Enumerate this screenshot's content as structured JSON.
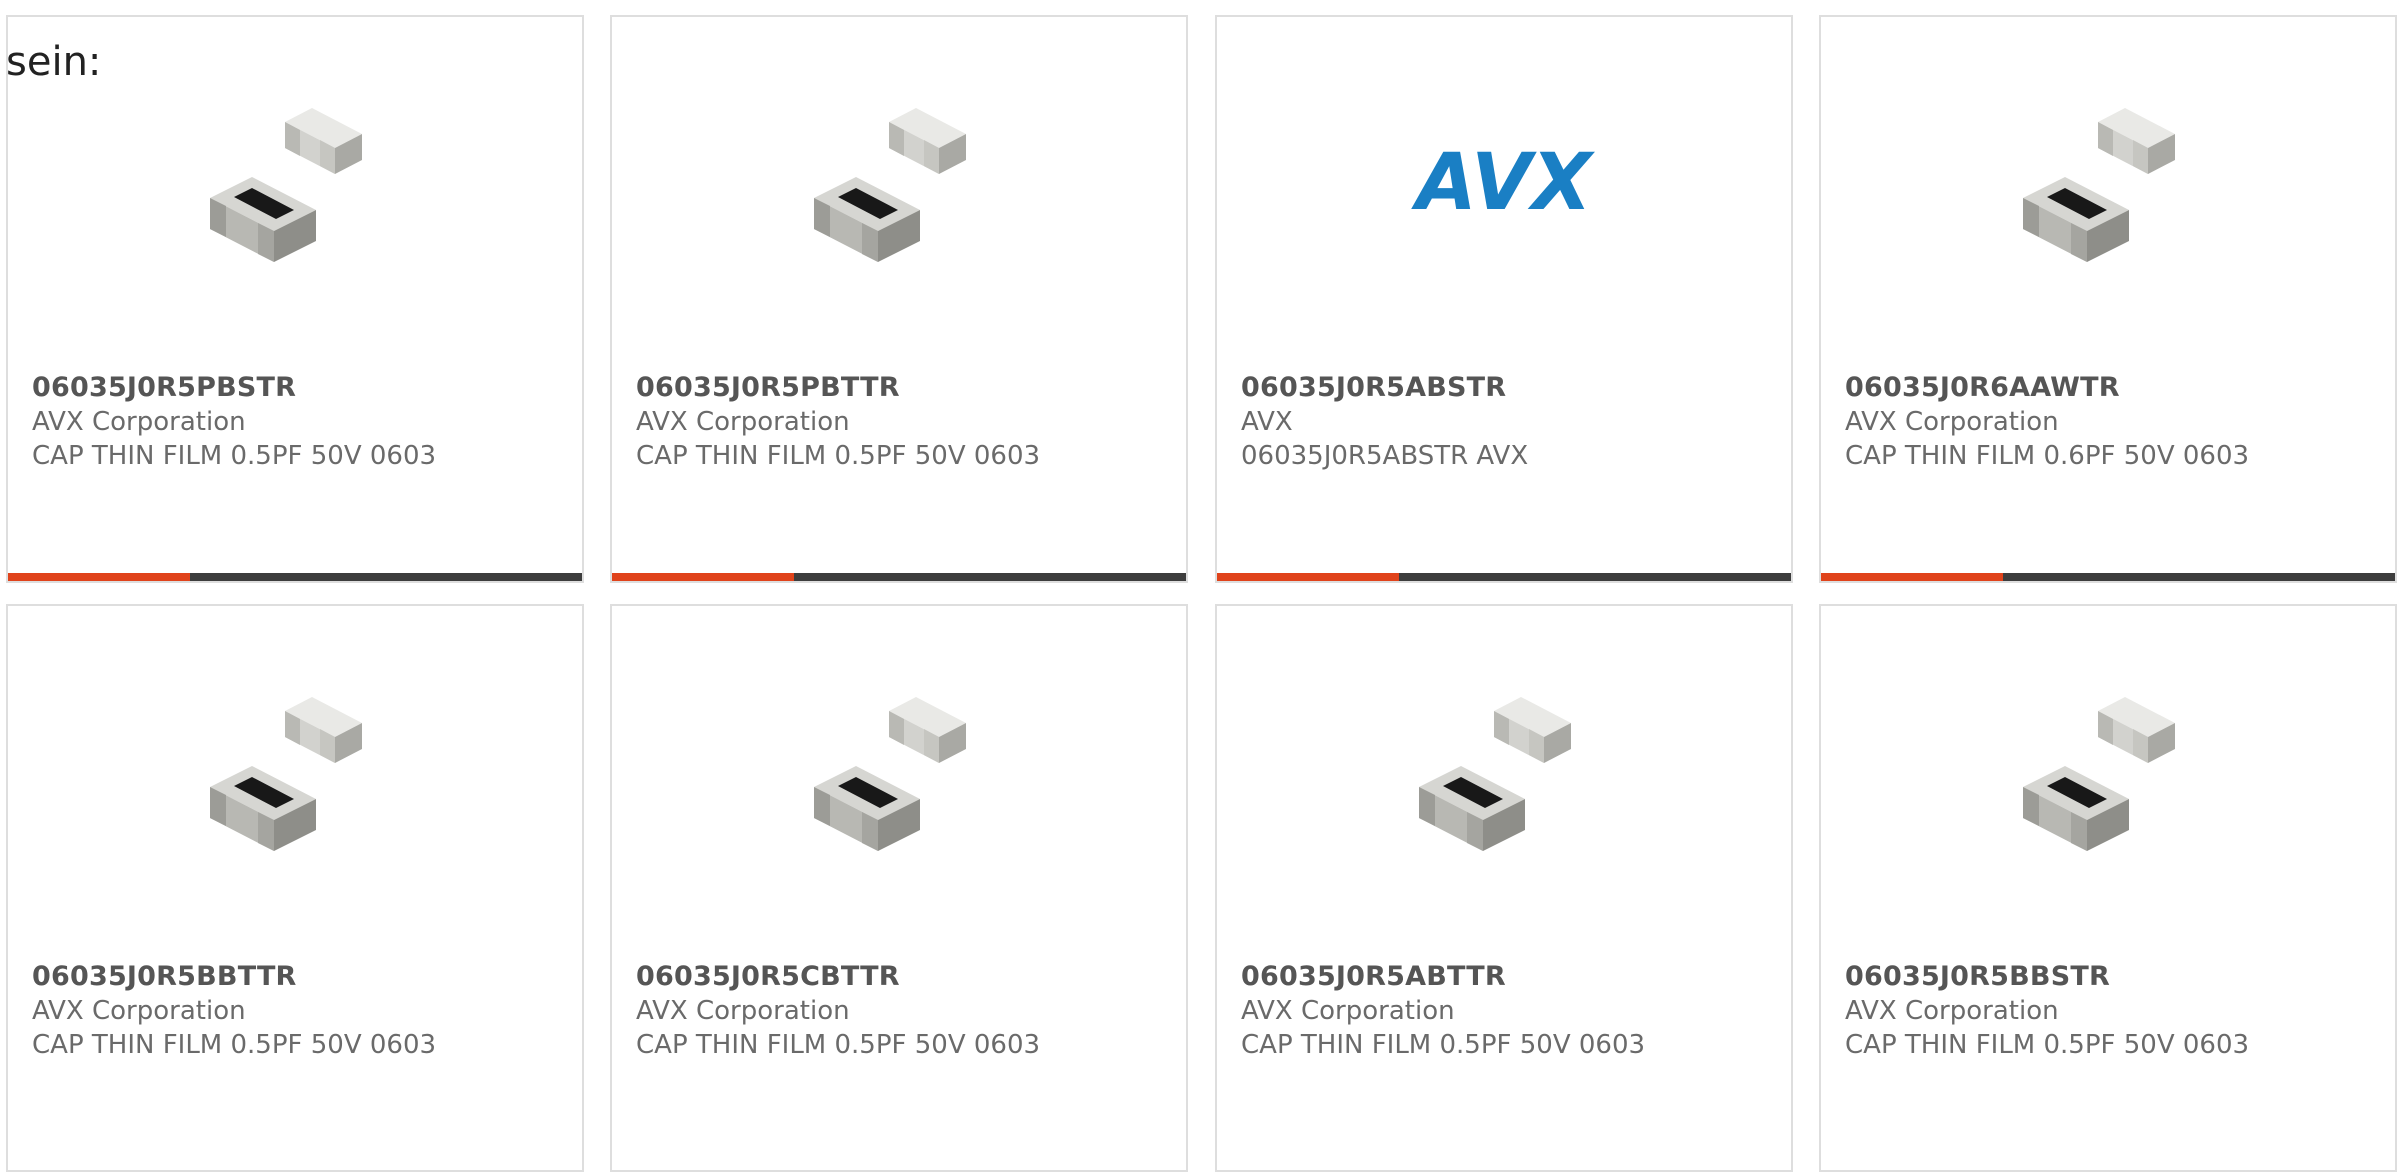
{
  "intro_text": "sein:",
  "colors": {
    "accent": "#e0431b",
    "bar": "#3d3d3d",
    "border": "#dedede",
    "avx_blue": "#1a7fc4"
  },
  "products": [
    {
      "part_number": "06035J0R5PBSTR",
      "manufacturer": "AVX Corporation",
      "description": "CAP THIN FILM 0.5PF 50V 0603",
      "image": "chip-capacitor"
    },
    {
      "part_number": "06035J0R5PBTTR",
      "manufacturer": "AVX Corporation",
      "description": "CAP THIN FILM 0.5PF 50V 0603",
      "image": "chip-capacitor"
    },
    {
      "part_number": "06035J0R5ABSTR",
      "manufacturer": "AVX",
      "description": "06035J0R5ABSTR AVX",
      "image": "avx-logo",
      "logo_text": "AVX"
    },
    {
      "part_number": "06035J0R6AAWTR",
      "manufacturer": "AVX Corporation",
      "description": "CAP THIN FILM 0.6PF 50V 0603",
      "image": "chip-capacitor"
    },
    {
      "part_number": "06035J0R5BBTTR",
      "manufacturer": "AVX Corporation",
      "description": "CAP THIN FILM 0.5PF 50V 0603",
      "image": "chip-capacitor"
    },
    {
      "part_number": "06035J0R5CBTTR",
      "manufacturer": "AVX Corporation",
      "description": "CAP THIN FILM 0.5PF 50V 0603",
      "image": "chip-capacitor"
    },
    {
      "part_number": "06035J0R5ABTTR",
      "manufacturer": "AVX Corporation",
      "description": "CAP THIN FILM 0.5PF 50V 0603",
      "image": "chip-capacitor"
    },
    {
      "part_number": "06035J0R5BBSTR",
      "manufacturer": "AVX Corporation",
      "description": "CAP THIN FILM 0.5PF 50V 0603",
      "image": "chip-capacitor"
    }
  ]
}
